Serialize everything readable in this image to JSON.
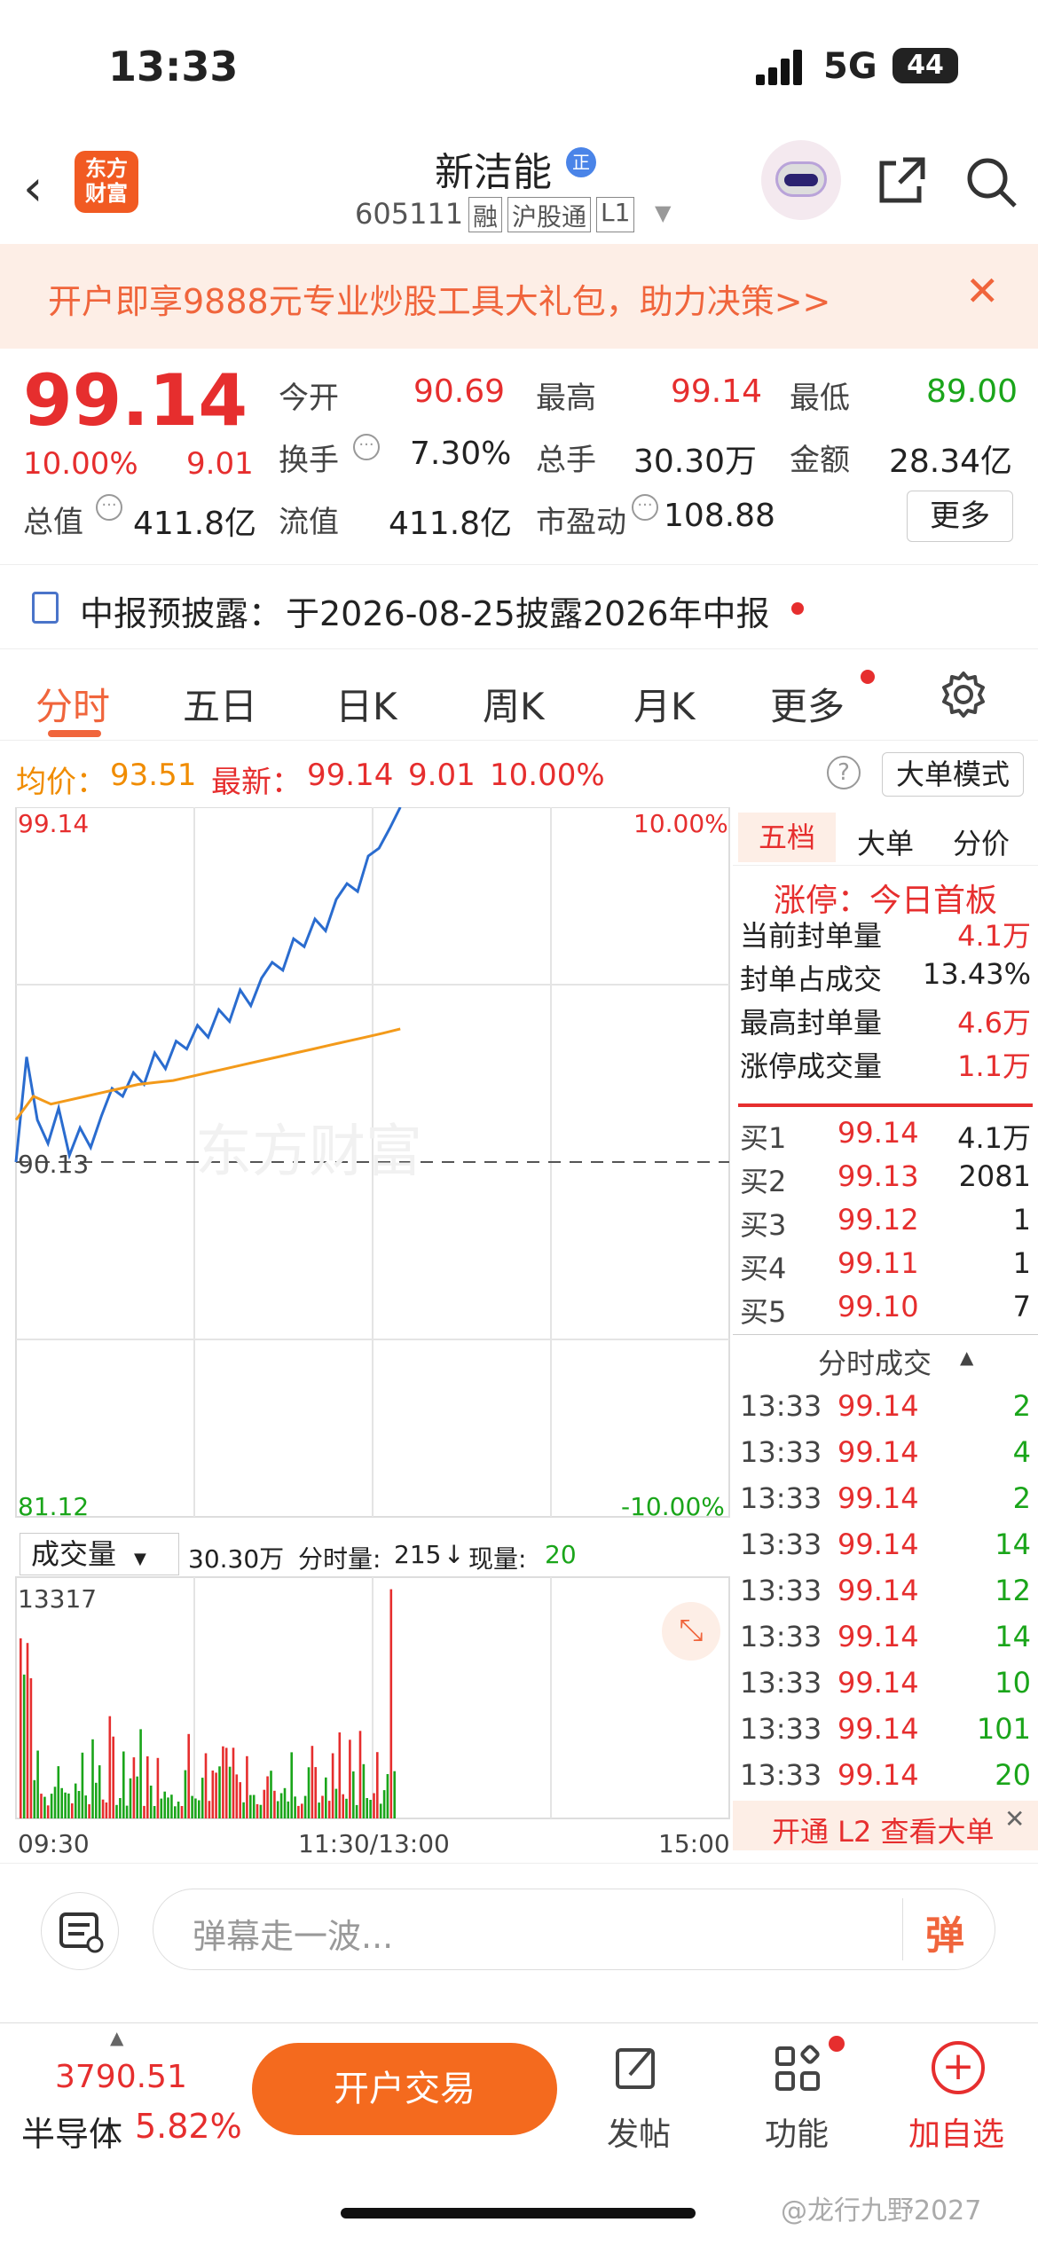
{
  "status": {
    "time": "13:33",
    "network": "5G",
    "battery": "44"
  },
  "header": {
    "stock_name": "新洁能",
    "badge": "正",
    "code": "605111",
    "tags": [
      "融",
      "沪股通",
      "L1"
    ],
    "logo_text": "东方财富"
  },
  "banner": {
    "text": "开户即享9888元专业炒股工具大礼包，助力决策>>"
  },
  "quote": {
    "price": "99.14",
    "change_pct": "10.00%",
    "change": "9.01",
    "fields": [
      {
        "label": "今开",
        "value": "90.69",
        "color": "#e62e2e"
      },
      {
        "label": "最高",
        "value": "99.14",
        "color": "#e62e2e"
      },
      {
        "label": "最低",
        "value": "89.00",
        "color": "#1aa51a"
      },
      {
        "label": "换手",
        "value": "7.30%",
        "color": "#222"
      },
      {
        "label": "总手",
        "value": "30.30万",
        "color": "#222"
      },
      {
        "label": "金额",
        "value": "28.34亿",
        "color": "#222"
      },
      {
        "label": "总值",
        "value": "411.8亿",
        "color": "#222"
      },
      {
        "label": "流值",
        "value": "411.8亿",
        "color": "#222"
      },
      {
        "label": "市盈动",
        "value": "108.88",
        "color": "#222"
      }
    ],
    "more_label": "更多"
  },
  "notice": {
    "label": "中报预披露：",
    "text": "于2026-08-25披露2026年中报"
  },
  "tabs": [
    {
      "label": "分时",
      "active": true
    },
    {
      "label": "五日"
    },
    {
      "label": "日K"
    },
    {
      "label": "周K"
    },
    {
      "label": "月K"
    },
    {
      "label": "更多"
    }
  ],
  "chart_info": {
    "avg_label": "均价：",
    "avg": "93.51",
    "latest_label": "最新：",
    "latest": "99.14",
    "change": "9.01",
    "pct": "10.00%",
    "mode_button": "大单模式"
  },
  "chart_data": {
    "type": "line",
    "price_axis": {
      "max": "99.14",
      "min": "81.12",
      "mid": "90.13",
      "pct_max": "10.00%",
      "pct_min": "-10.00%"
    },
    "time_labels": [
      "09:30",
      "11:30/13:00",
      "15:00"
    ],
    "ylim": [
      81.12,
      99.14
    ],
    "price_series": {
      "name": "最新",
      "values": [
        90.13,
        92.8,
        91.2,
        90.6,
        91.5,
        90.3,
        91.0,
        90.5,
        91.3,
        92.0,
        91.8,
        92.4,
        92.1,
        92.9,
        92.5,
        93.2,
        93.0,
        93.6,
        93.3,
        94.0,
        93.7,
        94.5,
        94.1,
        94.8,
        95.2,
        95.0,
        95.8,
        95.6,
        96.3,
        96.0,
        96.8,
        97.2,
        97.0,
        97.9,
        98.1,
        98.6,
        99.14
      ]
    },
    "avg_series": {
      "name": "均价",
      "values": [
        91.2,
        91.8,
        91.6,
        91.7,
        91.8,
        91.9,
        92.0,
        92.1,
        92.15,
        92.2,
        92.3,
        92.4,
        92.5,
        92.6,
        92.7,
        92.8,
        92.9,
        93.0,
        93.1,
        93.2,
        93.3,
        93.4,
        93.51
      ]
    },
    "volume": {
      "label": "成交量",
      "total": "30.30万",
      "minute_label": "分时量:",
      "minute": "215",
      "arrow": "↓",
      "current_label": "现量:",
      "current": "20",
      "max": "13317"
    }
  },
  "panel": {
    "tabs": [
      "五档",
      "大单",
      "分价"
    ],
    "limit_title": "涨停：今日首板",
    "stats": [
      {
        "label": "当前封单量",
        "value": "4.1万",
        "red": true
      },
      {
        "label": "封单占成交",
        "value": "13.43%",
        "red": false
      },
      {
        "label": "最高封单量",
        "value": "4.6万",
        "red": true
      },
      {
        "label": "涨停成交量",
        "value": "1.1万",
        "red": true
      }
    ],
    "bids": [
      {
        "label": "买1",
        "price": "99.14",
        "vol": "4.1万"
      },
      {
        "label": "买2",
        "price": "99.13",
        "vol": "2081"
      },
      {
        "label": "买3",
        "price": "99.12",
        "vol": "1"
      },
      {
        "label": "买4",
        "price": "99.11",
        "vol": "1"
      },
      {
        "label": "买5",
        "price": "99.10",
        "vol": "7"
      }
    ],
    "trades_title": "分时成交",
    "trades": [
      {
        "t": "13:33",
        "p": "99.14",
        "v": "2"
      },
      {
        "t": "13:33",
        "p": "99.14",
        "v": "4"
      },
      {
        "t": "13:33",
        "p": "99.14",
        "v": "2"
      },
      {
        "t": "13:33",
        "p": "99.14",
        "v": "14"
      },
      {
        "t": "13:33",
        "p": "99.14",
        "v": "12"
      },
      {
        "t": "13:33",
        "p": "99.14",
        "v": "14"
      },
      {
        "t": "13:33",
        "p": "99.14",
        "v": "10"
      },
      {
        "t": "13:33",
        "p": "99.14",
        "v": "101"
      },
      {
        "t": "13:33",
        "p": "99.14",
        "v": "20"
      }
    ],
    "l2_text": "开通 L2 查看大单"
  },
  "danmu": {
    "placeholder": "弹幕走一波...",
    "send": "弹"
  },
  "bottom": {
    "index_value": "3790.51",
    "sector": "半导体",
    "sector_pct": "5.82%",
    "trade_button": "开户交易",
    "post": "发帖",
    "func": "功能",
    "watch": "加自选"
  },
  "watermark": "@龙行九野2027"
}
